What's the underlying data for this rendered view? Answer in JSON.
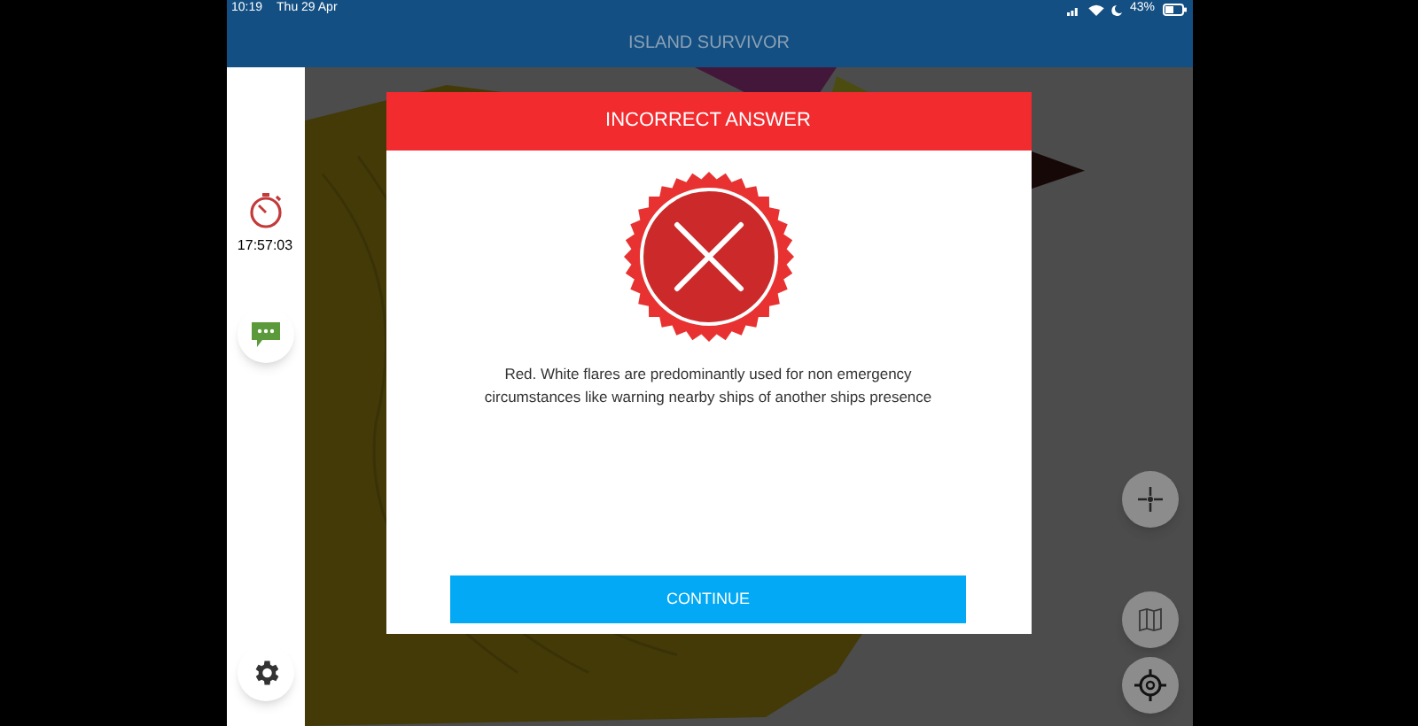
{
  "status_bar": {
    "time": "10:19",
    "date": "Thu 29 Apr",
    "battery": "43%"
  },
  "header": {
    "title": "ISLAND SURVIVOR"
  },
  "sidebar": {
    "timer": "17:57:03"
  },
  "dialog": {
    "title": "INCORRECT ANSWER",
    "message": "Red. White flares are predominantly used for non emergency circumstances like warning nearby ships of another ships presence",
    "button": "CONTINUE"
  }
}
